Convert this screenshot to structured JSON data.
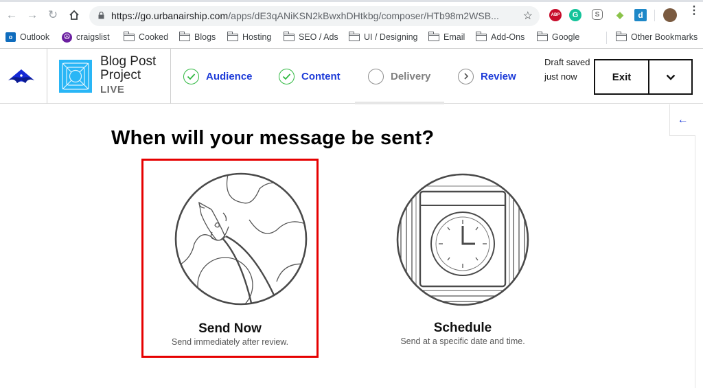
{
  "browser": {
    "url_host": "https://go.urbanairship.com",
    "url_path": "/apps/dE3qANiKSN2kBwxhDHtkbg/composer/HTb98m2WSB...",
    "nav": {
      "back": "back-arrow",
      "forward": "forward-arrow",
      "reload": "reload",
      "home": "home"
    },
    "extensions": [
      {
        "name": "adblock-plus",
        "label": "ABP",
        "color": "#c70d2c"
      },
      {
        "name": "grammarly",
        "label": "G",
        "color": "#15c39a"
      },
      {
        "name": "skype",
        "label": "S",
        "color": "#6f6f6f"
      },
      {
        "name": "extension-diamond",
        "label": "",
        "color": "#8bc34a"
      },
      {
        "name": "diigo",
        "label": "d",
        "color": "#1e88c8"
      }
    ],
    "bookmarks": [
      {
        "label": "Outlook",
        "icon": "outlook"
      },
      {
        "label": "craigslist",
        "icon": "peace"
      },
      {
        "label": "Cooked",
        "icon": "folder"
      },
      {
        "label": "Blogs",
        "icon": "folder"
      },
      {
        "label": "Hosting",
        "icon": "folder"
      },
      {
        "label": "SEO / Ads",
        "icon": "folder"
      },
      {
        "label": "UI / Designing",
        "icon": "folder"
      },
      {
        "label": "Email",
        "icon": "folder"
      },
      {
        "label": "Add-Ons",
        "icon": "folder"
      },
      {
        "label": "Google",
        "icon": "folder"
      }
    ],
    "other_bookmarks": "Other Bookmarks"
  },
  "header": {
    "project_title": "Blog Post Project",
    "project_title_line1": "Blog Post",
    "project_title_line2": "Project",
    "project_status": "LIVE",
    "steps": [
      {
        "label": "Audience",
        "state": "complete"
      },
      {
        "label": "Content",
        "state": "complete"
      },
      {
        "label": "Delivery",
        "state": "current"
      },
      {
        "label": "Review",
        "state": "next"
      }
    ],
    "draft_status": "Draft saved just now",
    "exit_label": "Exit",
    "colors": {
      "accent": "#1d3bd8",
      "complete": "#2eb83f",
      "project_icon": "#29b6f6"
    }
  },
  "main": {
    "heading": "When will your message be sent?",
    "options": [
      {
        "title": "Send Now",
        "description": "Send immediately after review.",
        "icon": "rocket-planet",
        "selected": true
      },
      {
        "title": "Schedule",
        "description": "Send at a specific date and time.",
        "icon": "calendar-clock",
        "selected": false
      }
    ],
    "selection_outline_color": "#e60000"
  }
}
